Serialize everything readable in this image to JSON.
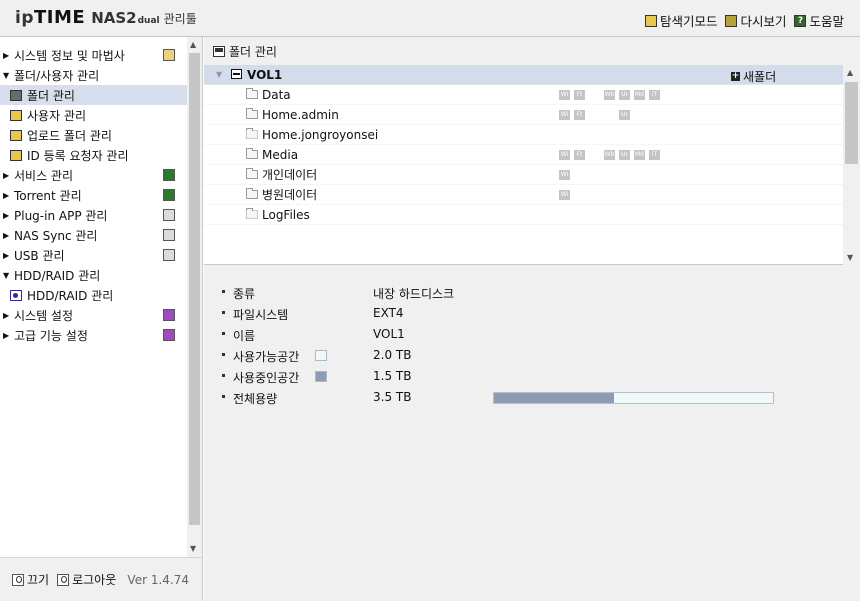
{
  "header": {
    "logo": {
      "ip": "ip",
      "time": "TIME",
      "nas": "NAS2",
      "dual": "dual",
      "mgr": "관리툴"
    },
    "links": [
      {
        "label": "탐색기모드",
        "icon": "explorer-mode-icon"
      },
      {
        "label": "다시보기",
        "icon": "refresh-icon"
      },
      {
        "label": "도움말",
        "icon": "help-icon"
      }
    ]
  },
  "sidebar": {
    "items": [
      {
        "label": "시스템 정보 및 마법사",
        "type": "collapsed",
        "icon": "system-info-icon"
      },
      {
        "label": "폴더/사용자 관리",
        "type": "expanded"
      },
      {
        "label": "폴더 관리",
        "type": "sub",
        "active": true
      },
      {
        "label": "사용자 관리",
        "type": "sub"
      },
      {
        "label": "업로드 폴더 관리",
        "type": "sub"
      },
      {
        "label": "ID 등록 요청자 관리",
        "type": "sub"
      },
      {
        "label": "서비스 관리",
        "type": "collapsed",
        "icon": "service-icon"
      },
      {
        "label": "Torrent 관리",
        "type": "collapsed",
        "icon": "torrent-icon"
      },
      {
        "label": "Plug-in APP 관리",
        "type": "collapsed",
        "icon": "plugin-icon"
      },
      {
        "label": "NAS Sync 관리",
        "type": "collapsed",
        "icon": "sync-icon"
      },
      {
        "label": "USB 관리",
        "type": "collapsed",
        "icon": "usb-icon"
      },
      {
        "label": "HDD/RAID 관리",
        "type": "expanded"
      },
      {
        "label": "HDD/RAID 관리",
        "type": "sub"
      },
      {
        "label": "시스템 설정",
        "type": "collapsed",
        "icon": "system-settings-icon"
      },
      {
        "label": "고급 기능 설정",
        "type": "collapsed",
        "icon": "advanced-settings-icon"
      }
    ],
    "footer": {
      "power": "끄기",
      "logout": "로그아웃",
      "version": "Ver 1.4.74"
    }
  },
  "main": {
    "panel_title": "폴더 관리",
    "volume": {
      "name": "VOL1",
      "new_folder": "새폴더"
    },
    "folders": [
      {
        "name": "Data",
        "services": [
          "Wi",
          "Ft",
          "Wb",
          "Ur",
          "Md",
          "iT"
        ]
      },
      {
        "name": "Home.admin",
        "services": [
          "Wi",
          "Ft",
          "Ur"
        ]
      },
      {
        "name": "Home.jongroyonsei",
        "services": []
      },
      {
        "name": "Media",
        "services": [
          "Wi",
          "Ft",
          "Wb",
          "Ur",
          "Md",
          "iT"
        ]
      },
      {
        "name": "개인데이터",
        "services": [
          "Wi"
        ]
      },
      {
        "name": "병원데이터",
        "services": [
          "Wi"
        ]
      },
      {
        "name": "LogFiles",
        "services": []
      }
    ],
    "properties": [
      {
        "key": "종류",
        "value": "내장 하드디스크"
      },
      {
        "key": "파일시스템",
        "value": "EXT4"
      },
      {
        "key": "이름",
        "value": "VOL1"
      },
      {
        "key": "사용가능공간",
        "value": "2.0 TB",
        "swatch": "#eef9f8"
      },
      {
        "key": "사용중인공간",
        "value": "1.5 TB",
        "swatch": "#8d9cb4"
      },
      {
        "key": "전체용량",
        "value": "3.5 TB",
        "used_fraction": 0.43
      }
    ]
  }
}
